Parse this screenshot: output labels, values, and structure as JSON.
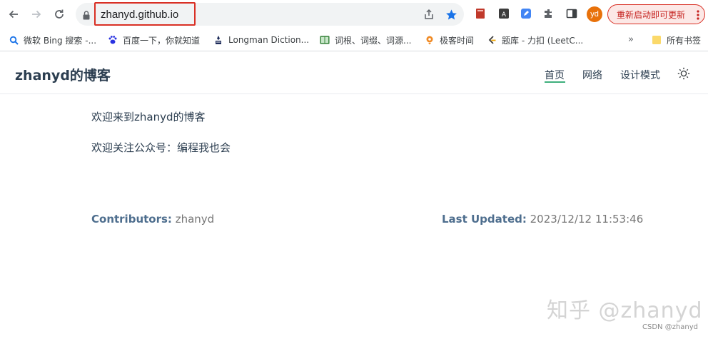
{
  "browser": {
    "url": "zhanyd.github.io",
    "avatar_initials": "yd",
    "update_button_label": "重新启动即可更新",
    "accent_color": "#d93025",
    "icons": [
      "back-arrow-icon",
      "forward-arrow-icon",
      "reload-icon",
      "lock-icon",
      "share-icon",
      "star-icon",
      "extensions-puzzle-icon",
      "side-panel-icon",
      "more-vert-icon"
    ]
  },
  "bookmarks": {
    "items": [
      {
        "label": "微软 Bing 搜索 -...",
        "icon": "bing-search-icon"
      },
      {
        "label": "百度一下，你就知道",
        "icon": "baidu-paw-icon"
      },
      {
        "label": "Longman Diction...",
        "icon": "longman-icon"
      },
      {
        "label": "词根、词缀、词源...",
        "icon": "book-icon"
      },
      {
        "label": "极客时间",
        "icon": "geektime-icon"
      },
      {
        "label": "题库 - 力扣 (LeetC...",
        "icon": "leetcode-icon"
      }
    ],
    "more_label": "»",
    "all_bookmarks_label": "所有书签"
  },
  "site": {
    "title": "zhanyd的博客",
    "nav": [
      "首页",
      "网络",
      "设计模式"
    ],
    "active_nav": "首页",
    "theme_color": "#3eaf7c"
  },
  "content": {
    "paragraphs": [
      "欢迎来到zhanyd的博客",
      "欢迎关注公众号：编程我也会"
    ]
  },
  "footer": {
    "contributors_label": "Contributors:",
    "contributors_value": "zhanyd",
    "updated_label": "Last Updated:",
    "updated_value": "2023/12/12 11:53:46"
  },
  "watermark": {
    "text": "知乎 @zhanyd",
    "credit": "CSDN @zhanyd"
  }
}
